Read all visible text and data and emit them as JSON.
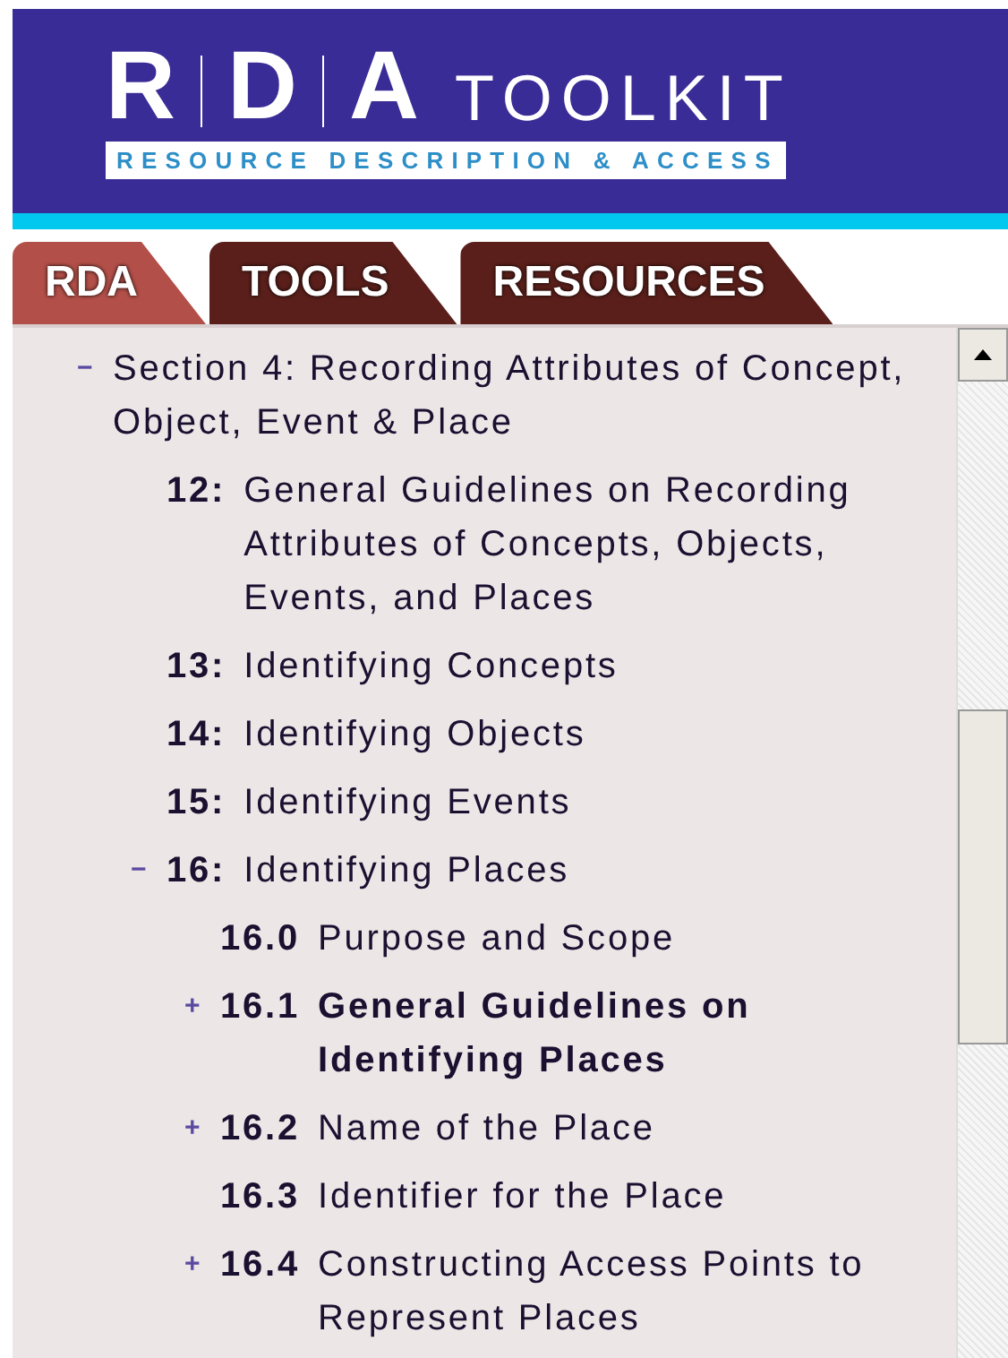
{
  "logo": {
    "letters": [
      "R",
      "D",
      "A"
    ],
    "word": "TOOLKIT",
    "tagline": "RESOURCE DESCRIPTION & ACCESS"
  },
  "tabs": [
    {
      "label": "RDA",
      "selected": true
    },
    {
      "label": "TOOLS",
      "selected": false
    },
    {
      "label": "RESOURCES",
      "selected": false
    }
  ],
  "tree": [
    {
      "toggle": "−",
      "title": "Section 4: Recording Attributes of Concept, Object, Event & Place",
      "selected": false,
      "children": [
        {
          "number": "12:",
          "title": "General Guidelines on Recording Attributes of Concepts, Objects, Events, and Places",
          "selected": false
        },
        {
          "number": "13:",
          "title": "Identifying Concepts",
          "selected": false
        },
        {
          "number": "14:",
          "title": "Identifying Objects",
          "selected": false
        },
        {
          "number": "15:",
          "title": "Identifying Events",
          "selected": false
        },
        {
          "toggle": "−",
          "number": "16:",
          "title": "Identifying Places",
          "selected": false,
          "children": [
            {
              "number": "16.0",
              "title": "Purpose and Scope",
              "selected": false
            },
            {
              "toggle": "+",
              "number": "16.1",
              "title": "General Guidelines on Identifying Places",
              "selected": true
            },
            {
              "toggle": "+",
              "number": "16.2",
              "title": "Name of the Place",
              "selected": false
            },
            {
              "number": "16.3",
              "title": "Identifier for the Place",
              "selected": false
            },
            {
              "toggle": "+",
              "number": "16.4",
              "title": "Constructing Access Points to Represent Places",
              "selected": false
            }
          ]
        }
      ]
    }
  ]
}
